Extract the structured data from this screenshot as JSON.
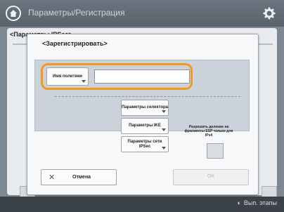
{
  "header": {
    "title": "Параметры/Регистрация",
    "home_icon": "home-icon",
    "settings_icon": "gear-icon"
  },
  "background_panel": {
    "title": "<Параметры IPSec>"
  },
  "dialog": {
    "title": "<Зарегистрировать>",
    "name_button": "Имя политики",
    "name_input_value": "",
    "standard_params_button": "Параметры селектора",
    "ms_params_button": "Параметры IKE",
    "ipsec_params_button": "Параметры сети IPSec",
    "note": "Разрешить деление на фрагменты ESP только для IPv4",
    "cancel_button": "Отмена",
    "ok_button": "OK"
  },
  "footer": {
    "status": "Вып. этапы"
  },
  "colors": {
    "highlight": "#f29a1e",
    "header": "#5a636c"
  }
}
